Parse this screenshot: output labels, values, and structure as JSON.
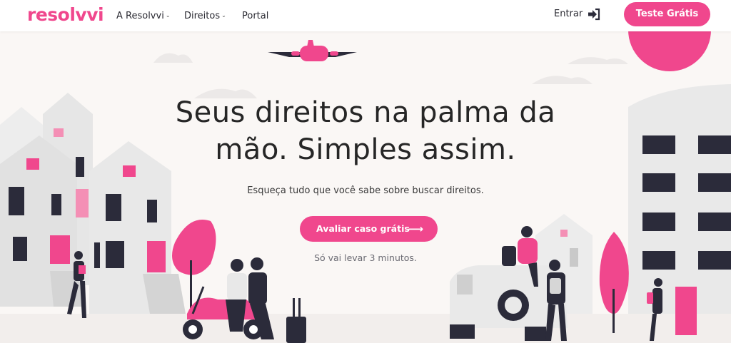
{
  "nav": {
    "logo": "resolvvi",
    "items": [
      {
        "label": "A Resolvvi",
        "has_dropdown": true
      },
      {
        "label": "Direitos",
        "has_dropdown": true
      },
      {
        "label": "Portal",
        "has_dropdown": false
      }
    ],
    "login_label": "Entrar",
    "login_icon": "sign-in-icon",
    "cta_label": "Teste Grátis"
  },
  "hero": {
    "title_line1": "Seus direitos na palma da",
    "title_line2": "mão. Simples assim.",
    "subtitle": "Esqueça tudo que você sabe sobre buscar direitos.",
    "cta_label": "Avaliar caso grátis",
    "cta_icon": "arrow-right-icon",
    "note": "Só vai levar 3 minutos."
  },
  "colors": {
    "brand": "#f0478d",
    "dark": "#2b2b3a",
    "building": "#e6e6e6"
  }
}
